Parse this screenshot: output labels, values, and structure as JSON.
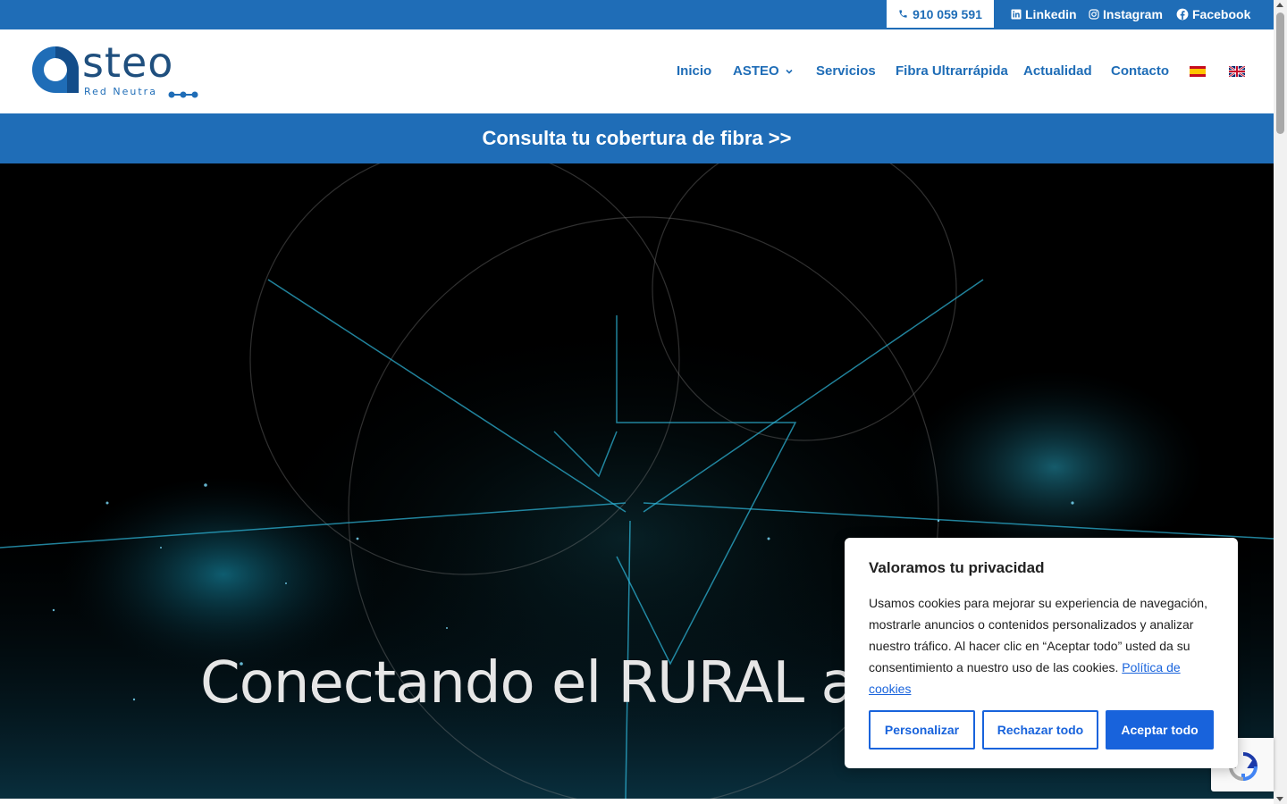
{
  "topbar": {
    "phone": "910 059 591",
    "linkedin": "Linkedin",
    "instagram": "Instagram",
    "facebook": "Facebook"
  },
  "logo": {
    "name": "steo",
    "tagline": "Red Neutra"
  },
  "nav": {
    "items": [
      "Inicio",
      "ASTEO",
      "Servicios",
      "Fibra Ultrarrápida",
      "Actualidad",
      "Contacto"
    ],
    "flags": [
      "spain-flag-icon",
      "uk-flag-icon"
    ]
  },
  "banner": {
    "text": "Consulta tu cobertura de fibra >>"
  },
  "hero": {
    "title": "Conectando el RURAL al mundo"
  },
  "cookie": {
    "title": "Valoramos tu privacidad",
    "body": "Usamos cookies para mejorar su experiencia de navegación, mostrarle anuncios o contenidos personalizados y analizar nuestro tráfico. Al hacer clic en “Aceptar todo” usted da su consentimiento a nuestro uso de las cookies.",
    "policy_link": "Política de cookies",
    "customize": "Personalizar",
    "reject": "Rechazar todo",
    "accept": "Aceptar todo"
  },
  "colors": {
    "brand": "#1f6db7",
    "cookie_accent": "#1863dc"
  }
}
